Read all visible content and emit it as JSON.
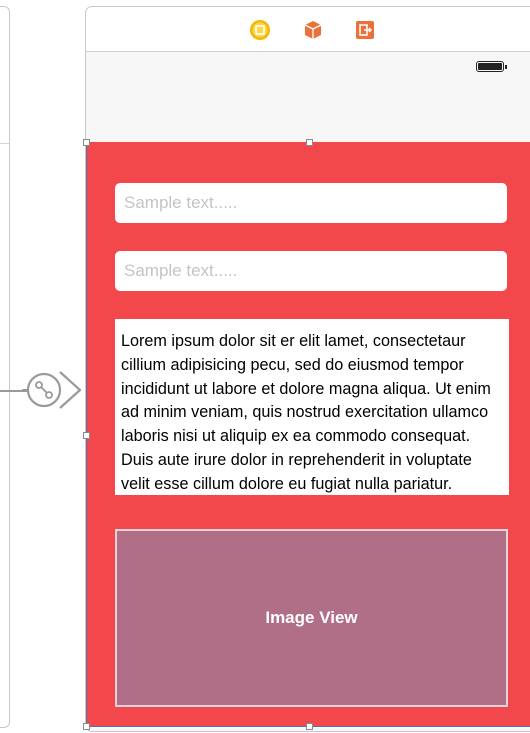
{
  "dock": {
    "icons": [
      "view-controller-icon",
      "first-responder-icon",
      "exit-icon"
    ]
  },
  "fields": [
    {
      "placeholder": "Sample text.....",
      "value": ""
    },
    {
      "placeholder": "Sample text.....",
      "value": ""
    }
  ],
  "text_view": {
    "text": "Lorem ipsum dolor sit er elit lamet, consectetaur cillium adipisicing pecu, sed do eiusmod tempor incididunt ut labore et dolore magna aliqua. Ut enim ad minim veniam, quis nostrud exercitation ullamco laboris nisi ut aliquip ex ea commodo consequat. Duis aute irure dolor in reprehenderit in voluptate velit esse cillum dolore eu fugiat nulla pariatur."
  },
  "image_view": {
    "label": "Image View"
  },
  "colors": {
    "view_background": "#f2484c",
    "image_view": "#b06f87",
    "dock_icon_yellow": "#f5b800",
    "dock_icon_orange": "#e8723a"
  }
}
